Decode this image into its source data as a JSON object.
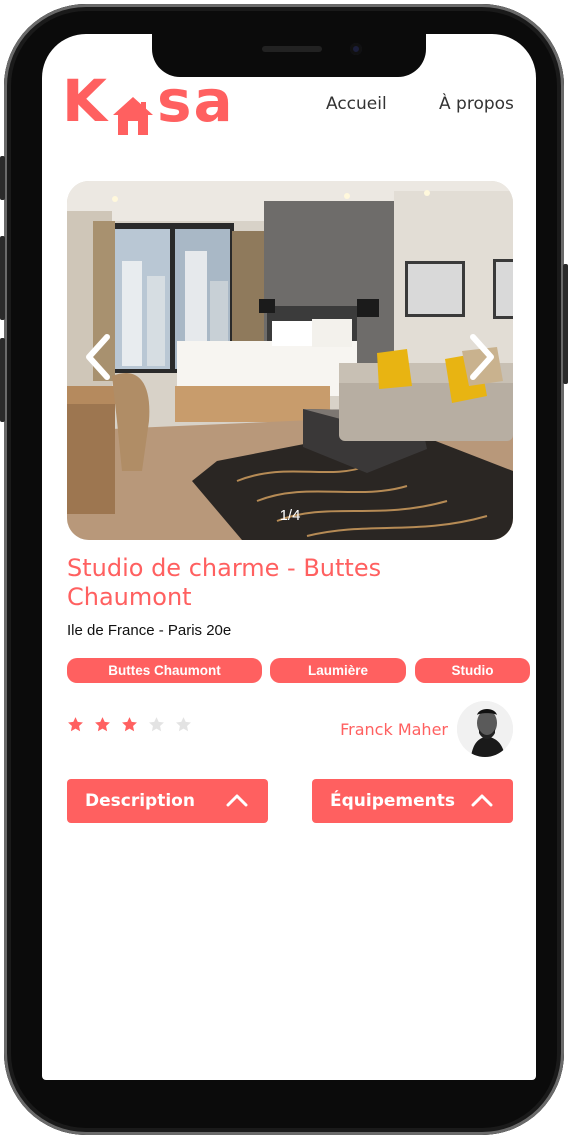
{
  "brand": {
    "logo_text_left": "K",
    "logo_text_right": "sa",
    "color": "#ff6060"
  },
  "nav": {
    "home_label": "Accueil",
    "about_label": "À propos"
  },
  "carousel": {
    "counter": "1/4",
    "current": 1,
    "total": 4
  },
  "listing": {
    "title": "Studio de charme - Buttes Chaumont",
    "location": "Ile de France - Paris 20e",
    "tags": [
      "Buttes Chaumont",
      "Laumière",
      "Studio"
    ],
    "rating": 3,
    "rating_max": 5
  },
  "host": {
    "name": "Franck Maher"
  },
  "sections": {
    "description_label": "Description",
    "equipment_label": "Équipements"
  },
  "colors": {
    "accent": "#ff6060",
    "star_off": "#e3e3e3"
  }
}
